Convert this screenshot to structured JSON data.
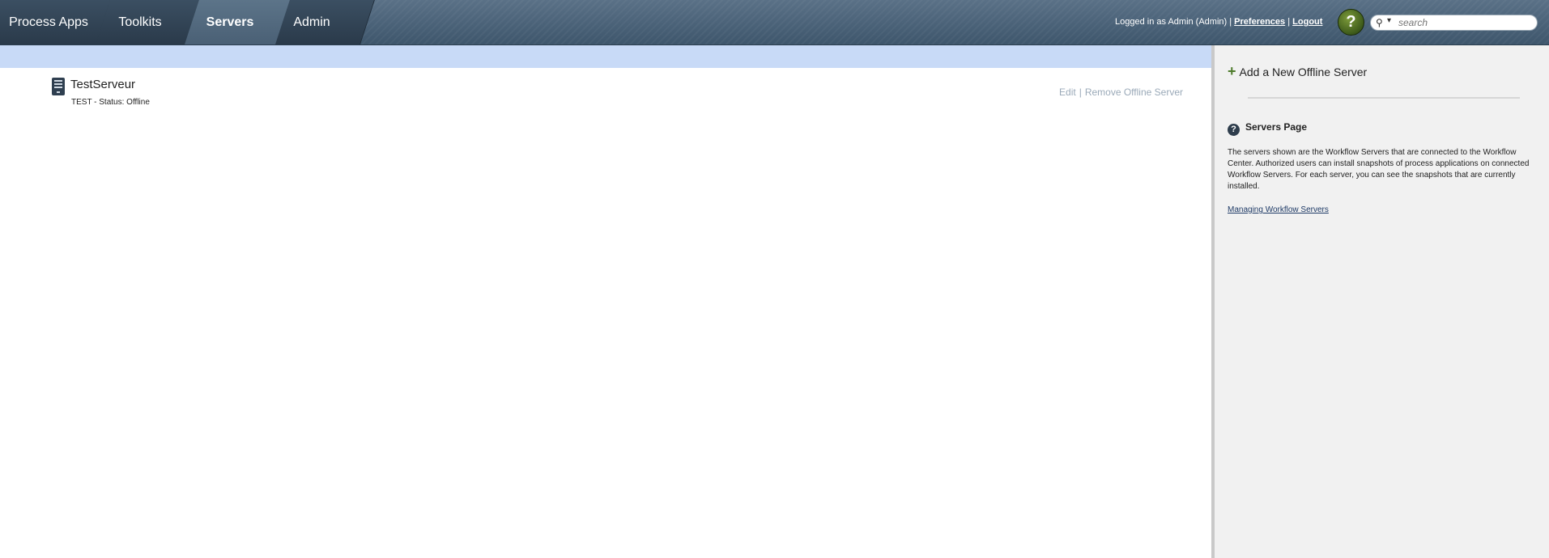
{
  "nav": {
    "tabs": [
      {
        "label": "Process Apps",
        "active": false
      },
      {
        "label": "Toolkits",
        "active": false
      },
      {
        "label": "Servers",
        "active": true
      },
      {
        "label": "Admin",
        "active": false
      }
    ]
  },
  "header": {
    "logged_in_text": "Logged in as Admin (Admin) |",
    "preferences_label": "Preferences",
    "separator": "|",
    "logout_label": "Logout",
    "help_label": "?",
    "search": {
      "placeholder": "search",
      "value": ""
    }
  },
  "servers": [
    {
      "name": "TestServeur",
      "status_line": "TEST - Status: Offline",
      "edit_label": "Edit",
      "separator": "|",
      "remove_label": "Remove Offline Server"
    }
  ],
  "sidebar": {
    "add_label": "Add a New Offline Server",
    "help_title": "Servers Page",
    "help_text": "The servers shown are the Workflow Servers that are connected to the Workflow Center. Authorized users can install snapshots of process applications on connected Workflow Servers. For each server, you can see the snapshots that are currently installed.",
    "help_link": "Managing Workflow Servers"
  },
  "colors": {
    "topbar": "#4a6075",
    "strip": "#c8daf7",
    "panel": "#f1f1f1",
    "add_icon": "#4d7a2a",
    "help_button": "#5a7a28"
  },
  "icons": [
    "search-icon",
    "chevron-down-icon",
    "help-icon",
    "server-icon",
    "plus-icon",
    "question-circle-icon"
  ]
}
